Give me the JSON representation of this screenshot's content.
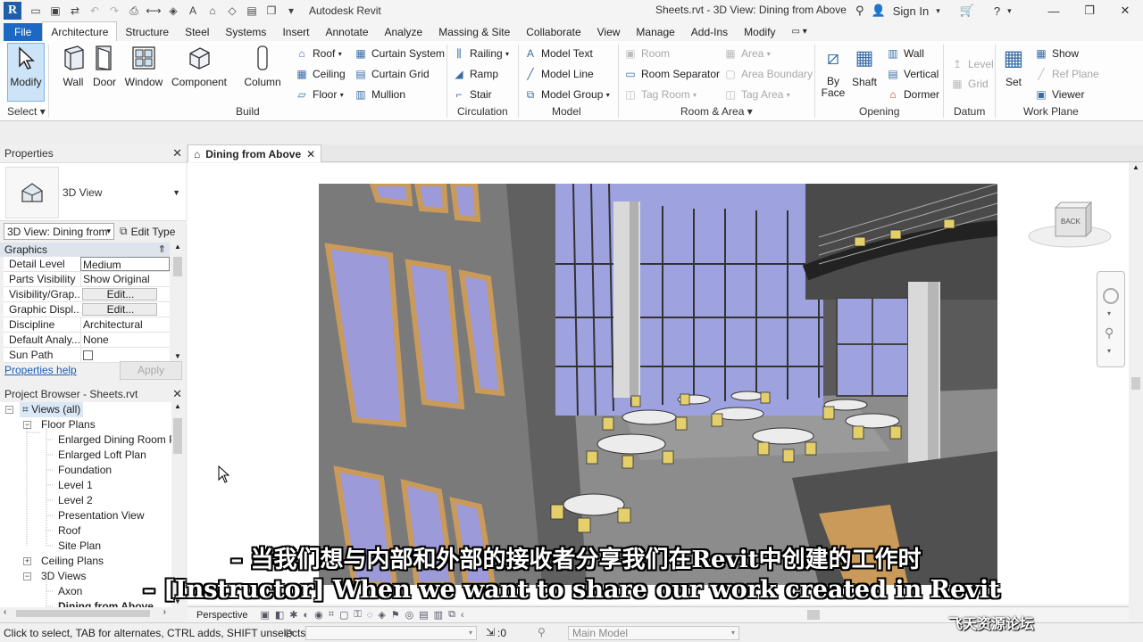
{
  "app": {
    "name": "Autodesk Revit",
    "document_title": "Sheets.rvt - 3D View: Dining from Above",
    "sign_in": "Sign In",
    "logo_letter": "R"
  },
  "tabs": [
    "File",
    "Architecture",
    "Structure",
    "Steel",
    "Systems",
    "Insert",
    "Annotate",
    "Analyze",
    "Massing & Site",
    "Collaborate",
    "View",
    "Manage",
    "Add-Ins",
    "Modify"
  ],
  "ribbon": {
    "select": {
      "modify": "Modify",
      "label": "Select"
    },
    "build": {
      "label": "Build",
      "wall": "Wall",
      "door": "Door",
      "window": "Window",
      "component": "Component",
      "column": "Column",
      "roof": "Roof",
      "ceiling": "Ceiling",
      "floor": "Floor",
      "curtain_system": "Curtain System",
      "curtain_grid": "Curtain Grid",
      "mullion": "Mullion"
    },
    "circulation": {
      "label": "Circulation",
      "railing": "Railing",
      "ramp": "Ramp",
      "stair": "Stair"
    },
    "model": {
      "label": "Model",
      "model_text": "Model Text",
      "model_line": "Model Line",
      "model_group": "Model Group"
    },
    "room_area": {
      "label": "Room & Area",
      "room": "Room",
      "room_separator": "Room Separator",
      "tag_room": "Tag Room",
      "area": "Area",
      "area_boundary": "Area Boundary",
      "tag_area": "Tag Area"
    },
    "opening": {
      "label": "Opening",
      "by_face_1": "By",
      "by_face_2": "Face",
      "shaft": "Shaft",
      "wall": "Wall",
      "vertical": "Vertical",
      "dormer": "Dormer"
    },
    "datum": {
      "label": "Datum",
      "level": "Level",
      "grid": "Grid"
    },
    "work_plane": {
      "label": "Work Plane",
      "set": "Set",
      "show": "Show",
      "ref_plane": "Ref Plane",
      "viewer": "Viewer"
    }
  },
  "properties": {
    "title": "Properties",
    "type_name": "3D View",
    "view_selector": "3D View: Dining from",
    "edit_type": "Edit Type",
    "section": "Graphics",
    "rows": [
      {
        "name": "Detail Level",
        "value": "Medium"
      },
      {
        "name": "Parts Visibility",
        "value": "Show Original"
      },
      {
        "name": "Visibility/Grap...",
        "value": "Edit..."
      },
      {
        "name": "Graphic Displ...",
        "value": "Edit..."
      },
      {
        "name": "Discipline",
        "value": "Architectural"
      },
      {
        "name": "Default Analy...",
        "value": "None"
      },
      {
        "name": "Sun Path",
        "value": ""
      }
    ],
    "help_link": "Properties help",
    "apply": "Apply"
  },
  "project_browser": {
    "title": "Project Browser - Sheets.rvt",
    "items": [
      {
        "label": "Views (all)"
      },
      {
        "label": "Floor Plans"
      },
      {
        "label": "Enlarged Dining Room Pla"
      },
      {
        "label": "Enlarged Loft Plan"
      },
      {
        "label": "Foundation"
      },
      {
        "label": "Level 1"
      },
      {
        "label": "Level 2"
      },
      {
        "label": "Presentation View"
      },
      {
        "label": "Roof"
      },
      {
        "label": "Site Plan"
      },
      {
        "label": "Ceiling Plans"
      },
      {
        "label": "3D Views"
      },
      {
        "label": "Axon"
      },
      {
        "label": "Dining from Above"
      }
    ]
  },
  "view_tab": {
    "label": "Dining from Above"
  },
  "viewcube": {
    "face": "BACK"
  },
  "view_control": {
    "mode": "Perspective"
  },
  "status": {
    "text": "Click to select, TAB for alternates, CTRL adds, SHIFT unselects.",
    "count": ":0",
    "model": "Main Model"
  },
  "subtitles": {
    "cn": "– 当我们想与内部和外部的接收者分享我们在Revit中创建的工作时",
    "en": "– [Instructor] When we want to share our work created in Revit"
  },
  "watermark": "飞天资源论坛",
  "colors": {
    "file_tab": "#1c68c2",
    "accent": "#1f5fa8",
    "selection": "#cde3f7"
  }
}
